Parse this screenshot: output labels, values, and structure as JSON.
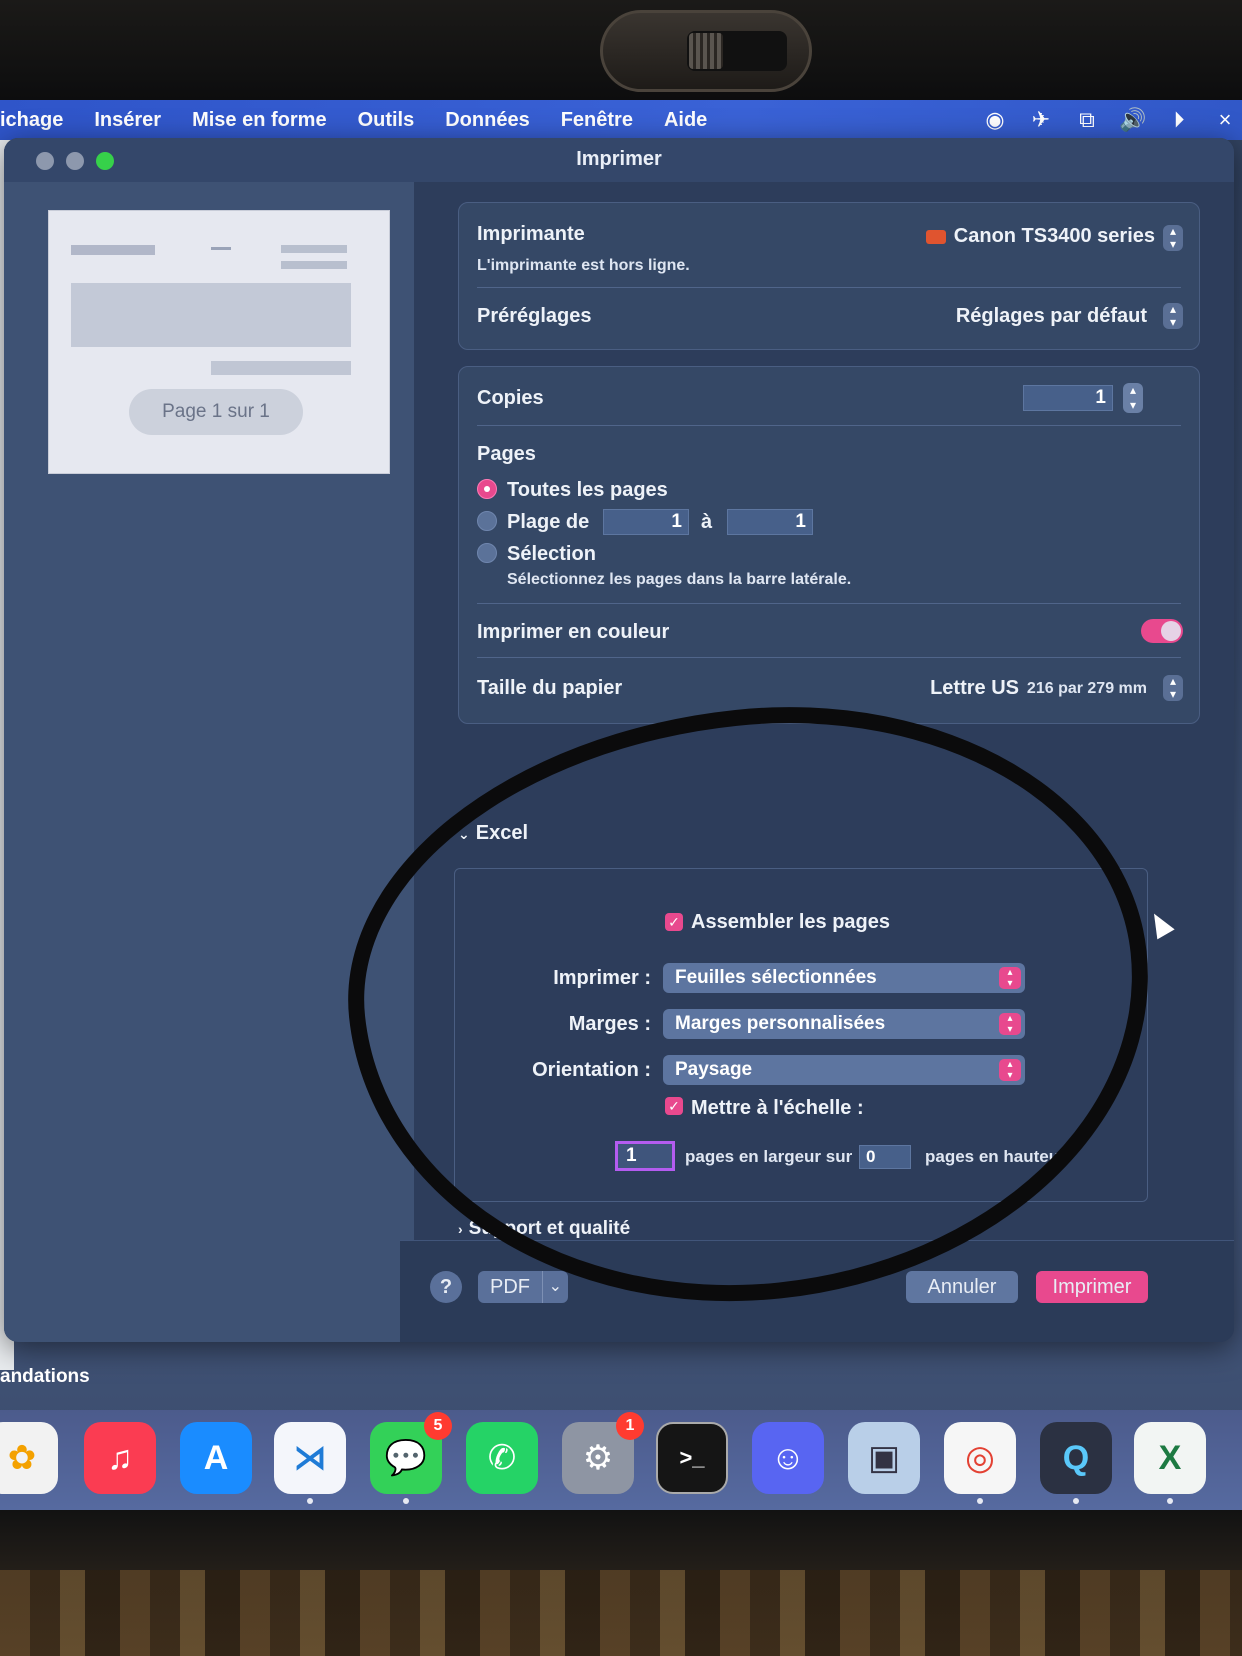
{
  "menubar": {
    "items": [
      "ichage",
      "Insérer",
      "Mise en forme",
      "Outils",
      "Données",
      "Fenêtre",
      "Aide"
    ]
  },
  "dialog": {
    "title": "Imprimer",
    "preview": {
      "page_label": "Page 1 sur 1"
    },
    "printer": {
      "label": "Imprimante",
      "value": "Canon TS3400 series",
      "status": "L'imprimante est hors ligne."
    },
    "presets": {
      "label": "Préréglages",
      "value": "Réglages par défaut"
    },
    "copies": {
      "label": "Copies",
      "value": "1"
    },
    "pages": {
      "label": "Pages",
      "all": "Toutes les pages",
      "range": "Plage de",
      "range_from": "1",
      "range_to_label": "à",
      "range_to": "1",
      "selection": "Sélection",
      "selection_hint": "Sélectionnez les pages dans la barre latérale."
    },
    "color": {
      "label": "Imprimer en couleur",
      "enabled": true
    },
    "paper": {
      "label": "Taille du papier",
      "value": "Lettre US",
      "detail": "216 par 279 mm"
    },
    "excel": {
      "section_label": "Excel",
      "collate": "Assembler les pages",
      "print_label": "Imprimer :",
      "print_value": "Feuilles sélectionnées",
      "margins_label": "Marges :",
      "margins_value": "Marges personnalisées",
      "orientation_label": "Orientation :",
      "orientation_value": "Paysage",
      "scale_label": "Mettre à l'échelle :",
      "pages_wide": "1",
      "pages_wide_label": "pages en largeur sur",
      "pages_tall": "0",
      "pages_tall_label": "pages en hauteur"
    },
    "media_quality": "Support et qualité",
    "footer": {
      "help": "?",
      "pdf": "PDF",
      "cancel": "Annuler",
      "print": "Imprimer"
    }
  },
  "behind_text": "andations",
  "dock": {
    "icons": [
      {
        "name": "photos-icon",
        "color": "#f2f2f2"
      },
      {
        "name": "music-icon",
        "color": "#fb3c52"
      },
      {
        "name": "app-store-icon",
        "color": "#1a8cff"
      },
      {
        "name": "vscode-icon",
        "color": "#f4f6fb"
      },
      {
        "name": "messages-icon",
        "color": "#33d158",
        "badge": "5"
      },
      {
        "name": "whatsapp-icon",
        "color": "#25d366"
      },
      {
        "name": "system-settings-icon",
        "color": "#8e95a3",
        "badge": "1"
      },
      {
        "name": "terminal-icon",
        "color": "#151515"
      },
      {
        "name": "discord-icon",
        "color": "#5865f2"
      },
      {
        "name": "preview-icon",
        "color": "#b9cfe8"
      },
      {
        "name": "chrome-icon",
        "color": "#f6f6f6"
      },
      {
        "name": "quicktime-icon",
        "color": "#2b3142"
      },
      {
        "name": "excel-icon",
        "color": "#f2f5f3"
      }
    ]
  },
  "colors": {
    "accent": "#e8498e",
    "menubar": "#3a62d6",
    "dialog_bg": "#2d3d5b"
  }
}
